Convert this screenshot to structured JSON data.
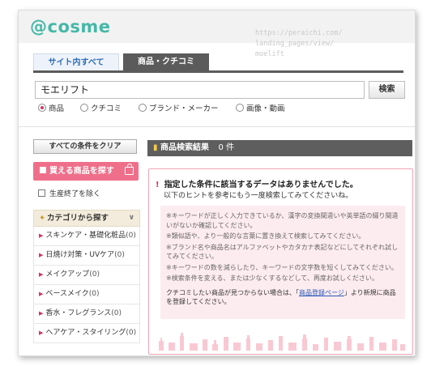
{
  "header": {
    "logo": "@cosme",
    "watermark": "https://peraichi.com/\nlanding_pages/view/\nmoelift"
  },
  "tabs": [
    {
      "label": "サイト内すべて"
    },
    {
      "label": "商品・クチコミ"
    }
  ],
  "search": {
    "value": "モエリフト",
    "button": "検索"
  },
  "radios": [
    {
      "label": "商品",
      "selected": true
    },
    {
      "label": "クチコミ",
      "selected": false
    },
    {
      "label": "ブランド・メーカー",
      "selected": false
    },
    {
      "label": "画像・動画",
      "selected": false
    }
  ],
  "sidebar": {
    "clear_button": "すべての条件をクリア",
    "buyable_button": "買える商品を探す",
    "discontinued": "生産終了を除く",
    "category_header": "カテゴリから探す",
    "categories": [
      {
        "label": "スキンケア・基礎化粧品",
        "count": "(0)"
      },
      {
        "label": "日焼け対策・UVケア",
        "count": "(0)"
      },
      {
        "label": "メイクアップ",
        "count": "(0)"
      },
      {
        "label": "ベースメイク",
        "count": "(0)"
      },
      {
        "label": "香水・フレグランス",
        "count": "(0)"
      },
      {
        "label": "ヘアケア・スタイリング",
        "count": "(0)"
      }
    ]
  },
  "results": {
    "title": "商品検索結果",
    "count": "0 件",
    "no_result_title": "指定した条件に該当するデータはありませんでした。",
    "no_result_sub": "以下のヒントを参考にもう一度検索してみてくださいね。",
    "hints": [
      "※キーワードが正しく入力できているか、漢字の変換間違いや英単語の綴り間違いがないか確認してください。",
      "※類似語や、より一般的な言葉に置き換えて検索してみてください。",
      "※ブランド名や商品名はアルファベットやカタカナ表記などにしてそれぞれ試してみてください。",
      "※キーワードの数を減らしたり、キーワードの文字数を短くしてみてください。",
      "※検索条件を変える、または少なくするなどして、再度お試しください。"
    ],
    "register_pre": "クチコミしたい商品が見つからない場合は、「",
    "register_link": "商品登録ページ",
    "register_post": "」より新規に商品を登録してください。"
  },
  "colors": {
    "brand": "#45b8a8",
    "accent": "#ef6f8a",
    "bar": "#5e5e5e"
  }
}
